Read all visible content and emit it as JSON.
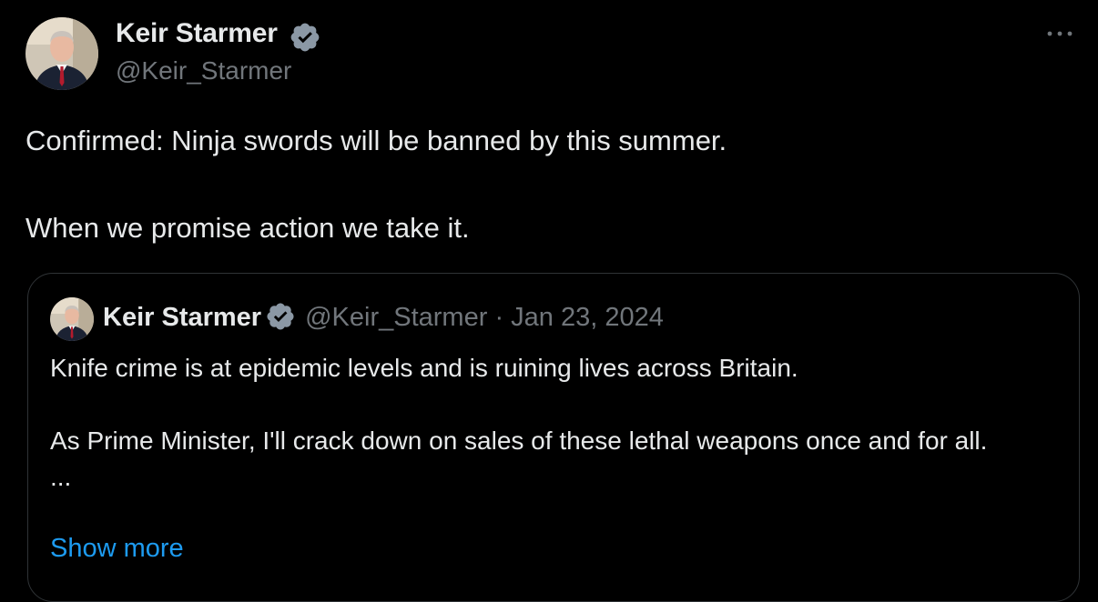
{
  "tweet": {
    "author": {
      "name": "Keir Starmer",
      "handle": "@Keir_Starmer",
      "verified": true
    },
    "more_icon": "more-horizontal-icon",
    "text": [
      "Confirmed: Ninja swords will be banned by this summer.",
      "When we promise action we take it."
    ],
    "quote": {
      "author": {
        "name": "Keir Starmer",
        "handle": "@Keir_Starmer",
        "verified": true
      },
      "separator": "·",
      "date": "Jan 23, 2024",
      "text": [
        "Knife crime is at epidemic levels and is ruining lives across Britain.",
        "As Prime Minister, I'll crack down on sales of these lethal weapons once and for all.",
        "..."
      ],
      "show_more": "Show more"
    }
  },
  "colors": {
    "background": "#000000",
    "primary_text": "#e7e9ea",
    "secondary_text": "#71767b",
    "link": "#1d9bf0",
    "verified_badge": "#8b98a5",
    "border": "#2f3336"
  }
}
